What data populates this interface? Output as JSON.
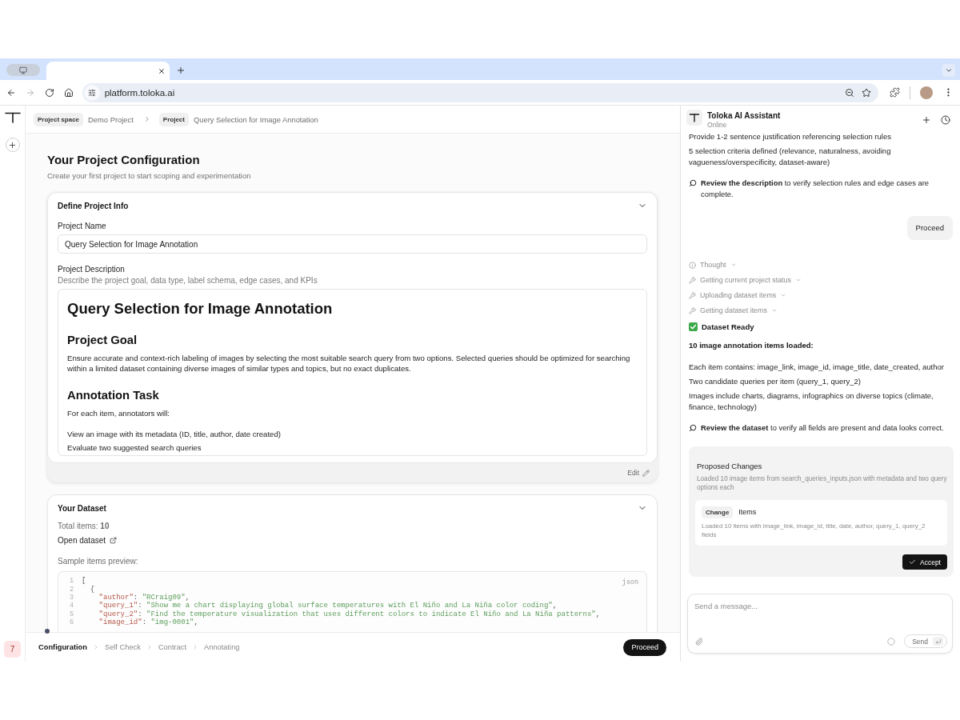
{
  "browser": {
    "forward_disabled": true,
    "url": "platform.toloka.ai"
  },
  "breadcrumb": [
    {
      "tag": "Project space",
      "label": "Demo Project"
    },
    {
      "tag": "Project",
      "label": "Query Selection for Image Annotation"
    }
  ],
  "rail": {
    "badge": "7"
  },
  "page": {
    "title": "Your Project Configuration",
    "subtitle": "Create your first project to start scoping and experimentation"
  },
  "project_info": {
    "title": "Define Project Info",
    "expanded": true,
    "name_label": "Project Name",
    "name_value": "Query Selection for Image Annotation",
    "description_label": "Project Description",
    "description_hint": "Describe the project goal, data type, label schema, edge cases, and KPIs",
    "description": [
      {
        "kind": "h1",
        "text": "Query Selection for Image Annotation"
      },
      {
        "kind": "h2",
        "text": "Project Goal"
      },
      {
        "kind": "p",
        "text": "Ensure accurate and context-rich labeling of images by selecting the most suitable search query from two options. Selected queries should be optimized for searching within a limited dataset containing diverse images of similar types and topics, but no exact duplicates."
      },
      {
        "kind": "h2",
        "text": "Annotation Task"
      },
      {
        "kind": "p",
        "text": "For each item, annotators will:"
      },
      {
        "kind": "item",
        "text": "View an image with its metadata (ID, title, author, date created)"
      },
      {
        "kind": "item",
        "text": "Evaluate two suggested search queries"
      }
    ],
    "edit": "Edit"
  },
  "dataset": {
    "title": "Your Dataset",
    "expanded": true,
    "total": "Total items: **10**",
    "open_link": "Open dataset",
    "preview_label": "Sample items preview:",
    "language": "json",
    "lines": [
      {
        "number": "1",
        "code": "["
      },
      {
        "number": "2",
        "code": "  {"
      },
      {
        "number": "3",
        "code": "    \"author\": \"RCraig09\","
      },
      {
        "number": "4",
        "code": "    \"query_1\": \"Show me a chart displaying global surface temperatures with El Niño and La Niña color coding\","
      },
      {
        "number": "5",
        "code": "    \"query_2\": \"Find the temperature visualization that uses different colors to indicate El Niño and La Niña patterns\","
      },
      {
        "number": "6",
        "code": "    \"image_id\": \"img-0001\","
      }
    ]
  },
  "stepper": {
    "steps": [
      {
        "label": "Configuration",
        "selected": true
      },
      {
        "label": "Self Check",
        "selected": false
      },
      {
        "label": "Contract",
        "selected": false
      },
      {
        "label": "Annotating",
        "selected": false
      }
    ],
    "proceed": "Proceed"
  },
  "assistant": {
    "title": "Toloka AI Assistant",
    "status": "Online",
    "messages": [
      {
        "kind": "text",
        "text": "Provide 1-2 sentence justification referencing selection rules"
      },
      {
        "kind": "text",
        "text": "5 selection criteria defined (relevance, naturalness, avoiding vagueness/overspecificity, dataset-aware)"
      },
      {
        "kind": "callout",
        "text": "**Review the description** to verify selection rules and edge cases are complete."
      },
      {
        "kind": "user",
        "text": "Proceed"
      },
      {
        "kind": "thought",
        "text": "Thought"
      },
      {
        "kind": "tool",
        "text": "Getting current project status"
      },
      {
        "kind": "tool",
        "text": "Uploading dataset items"
      },
      {
        "kind": "tool",
        "text": "Getting dataset items"
      },
      {
        "kind": "status",
        "text": "Dataset Ready"
      },
      {
        "kind": "heading",
        "text": "10 image annotation items loaded:"
      },
      {
        "kind": "text",
        "text": "Each item contains: image_link, image_id, image_title, date_created, author"
      },
      {
        "kind": "text",
        "text": "Two candidate queries per item (query_1, query_2)"
      },
      {
        "kind": "text",
        "text": "Images include charts, diagrams, infographics on diverse topics (climate, finance, technology)"
      },
      {
        "kind": "callout",
        "text": "**Review the dataset** to verify all fields are present and data looks correct."
      }
    ],
    "proposal": {
      "title": "Proposed Changes",
      "description": "Loaded 10 image items from search_queries_inputs.json with metadata and two query options each",
      "change": {
        "tag": "Change",
        "title": "Items",
        "description": "Loaded 10 items with image_link, image_id, title, date, author, query_1, query_2 fields"
      },
      "accept": "Accept"
    },
    "composer": {
      "placeholder": "Send a message...",
      "send": "Send"
    }
  }
}
